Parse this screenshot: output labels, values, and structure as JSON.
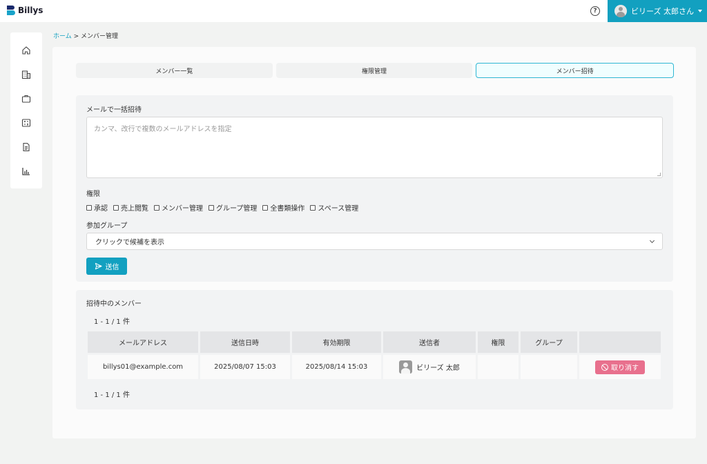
{
  "header": {
    "logo_text": "Billys",
    "help_icon": "question-circle-icon",
    "help_glyph": "?",
    "user_name": "ビリーズ 太郎さん"
  },
  "sidebar": {
    "items": [
      {
        "icon": "home-icon"
      },
      {
        "icon": "building-icon"
      },
      {
        "icon": "briefcase-icon"
      },
      {
        "icon": "calculator-icon"
      },
      {
        "icon": "document-icon"
      },
      {
        "icon": "bar-chart-icon"
      }
    ]
  },
  "breadcrumb": {
    "home": "ホーム",
    "separator": " > ",
    "current": "メンバー管理"
  },
  "tabs": [
    {
      "label": "メンバー一覧",
      "active": false
    },
    {
      "label": "権限管理",
      "active": false
    },
    {
      "label": "メンバー招待",
      "active": true
    }
  ],
  "invite_form": {
    "bulk_label": "メールで一括招待",
    "textarea_placeholder": "カンマ、改行で複数のメールアドレスを指定",
    "permission_label": "権限",
    "permissions": [
      "承認",
      "売上閲覧",
      "メンバー管理",
      "グループ管理",
      "全書類操作",
      "スペース管理"
    ],
    "group_label": "参加グループ",
    "group_select_value": "クリックで候補を表示",
    "send_label": "送信"
  },
  "pending": {
    "title": "招待中のメンバー",
    "count_top": "1 - 1 / 1 件",
    "count_bottom": "1 - 1 / 1 件",
    "columns": [
      "メールアドレス",
      "送信日時",
      "有効期限",
      "送信者",
      "権限",
      "グループ",
      ""
    ],
    "rows": [
      {
        "email": "billys01@example.com",
        "sent_at": "2025/08/07 15:03",
        "expires_at": "2025/08/14 15:03",
        "sender": "ビリーズ 太郎",
        "permission": "",
        "group": "",
        "action": "取り消す"
      }
    ]
  },
  "colors": {
    "accent": "#12a0c0",
    "danger": "#e8708d",
    "active_tab_bg": "#f0feff"
  }
}
